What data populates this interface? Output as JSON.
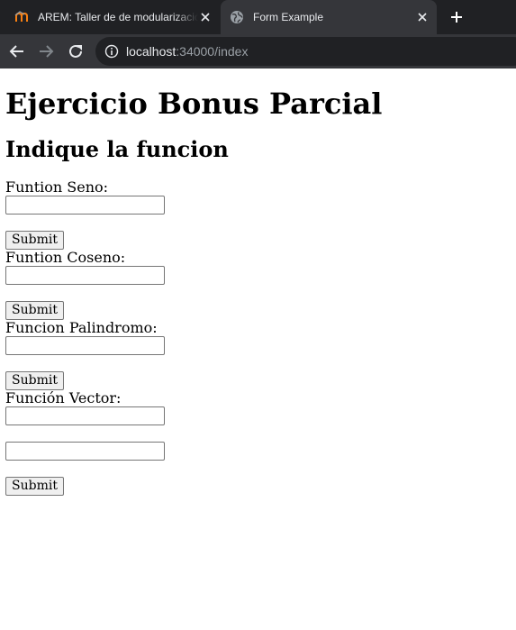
{
  "browser": {
    "tabs": [
      {
        "title": "AREM: Taller de de modularización",
        "active": false,
        "favicon": "moodle-logo-icon"
      },
      {
        "title": "Form Example",
        "active": true,
        "favicon": "globe-icon"
      }
    ],
    "url": {
      "host": "localhost",
      "path": ":34000/index"
    }
  },
  "page": {
    "heading": "Ejercicio Bonus Parcial",
    "subheading": "Indique la funcion",
    "forms": [
      {
        "label": "Funtion Seno:",
        "fields": [
          ""
        ],
        "submit_label": "Submit"
      },
      {
        "label": "Funtion Coseno:",
        "fields": [
          ""
        ],
        "submit_label": "Submit"
      },
      {
        "label": "Funcion Palindromo:",
        "fields": [
          ""
        ],
        "submit_label": "Submit"
      },
      {
        "label": "Función Vector:",
        "fields": [
          "",
          ""
        ],
        "submit_label": "Submit"
      }
    ]
  }
}
